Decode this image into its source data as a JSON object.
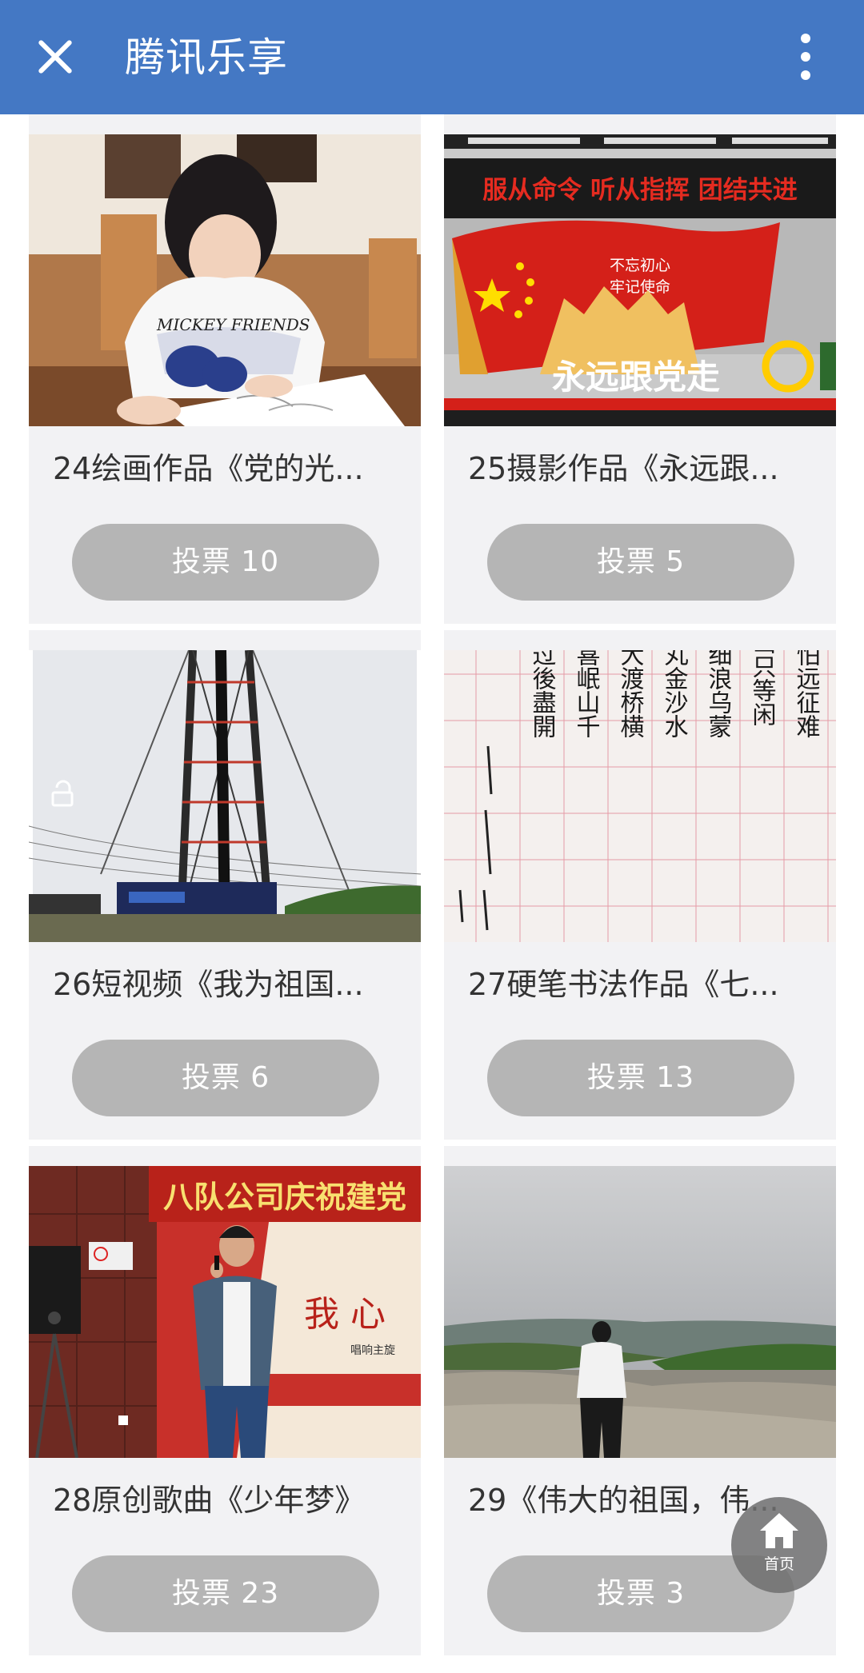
{
  "appbar": {
    "title": "腾讯乐享"
  },
  "items": [
    {
      "caption": "24绘画作品《党的光...",
      "vote": "投票 10"
    },
    {
      "caption": "25摄影作品《永远跟...",
      "vote": "投票 5"
    },
    {
      "caption": "26短视频《我为祖国...",
      "vote": "投票 6"
    },
    {
      "caption": "27硬笔书法作品《七...",
      "vote": "投票 13"
    },
    {
      "caption": "28原创歌曲《少年梦》",
      "vote": "投票 23"
    },
    {
      "caption": "29《伟大的祖国，伟...",
      "vote": "投票 3"
    }
  ],
  "photo_texts": {
    "banner": "服从命令 听从指挥 团结共进",
    "monument_top": "不忘初心",
    "monument_sub": "牢记使命",
    "monument_main": "永远跟党走",
    "stage_banner": "八队公司庆祝建党",
    "tshirt": "MICKEY FRIENDS",
    "stage_slogan": "唱响主旋",
    "stage_big": "我 心",
    "calligraphy_cols": [
      "军不怕远征难",
      "千山只等闲",
      "迤腾细浪乌蒙",
      "走泥丸金沙水",
      "崖暖大渡桥横",
      "寒更喜岷山千",
      "三军过後盡開"
    ]
  },
  "fab": {
    "label": "首页"
  },
  "colors": {
    "appbar": "#4478c4",
    "card_bg": "#f2f2f4",
    "vote_btn": "#b5b5b5"
  }
}
